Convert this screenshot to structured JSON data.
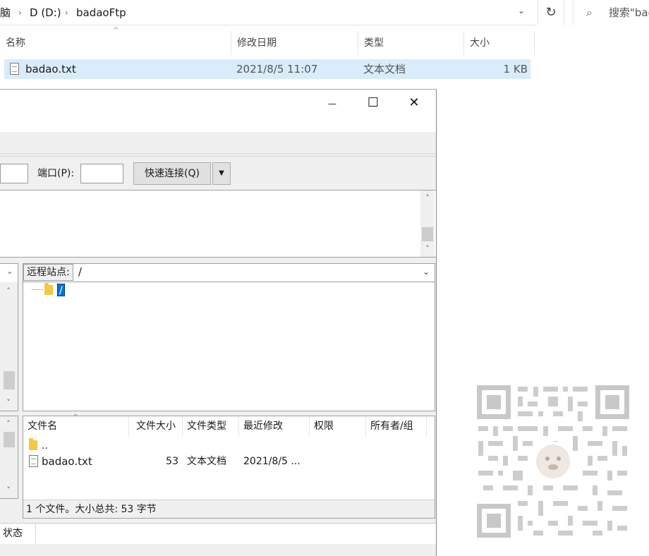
{
  "explorer": {
    "breadcrumb": [
      "脑",
      "D (D:)",
      "badaoFtp"
    ],
    "search_placeholder": "搜索\"bad",
    "columns": [
      "名称",
      "修改日期",
      "类型",
      "大小"
    ],
    "files": [
      {
        "name": "badao.txt",
        "modified": "2021/8/5 11:07",
        "type": "文本文档",
        "size": "1 KB"
      }
    ]
  },
  "filezilla": {
    "window_controls": {
      "minimize": "—",
      "maximize": "☐",
      "close": "✕"
    },
    "quickconnect": {
      "port_label": "端口(P):",
      "port_value": "",
      "connect_button": "快速连接(Q)",
      "dropdown": "▼"
    },
    "remote": {
      "site_label": "远程站点:",
      "site_path": "/",
      "tree_root": "/",
      "columns": [
        "文件名",
        "文件大小",
        "文件类型",
        "最近修改",
        "权限",
        "所有者/组"
      ],
      "rows": [
        {
          "name": "..",
          "size": "",
          "type": "",
          "modified": ""
        },
        {
          "name": "badao.txt",
          "size": "53",
          "type": "文本文档",
          "modified": "2021/8/5 ..."
        }
      ],
      "summary": "1 个文件。大小总共: 53 字节"
    },
    "status_tab": "状态"
  },
  "icons": {
    "chevron_right": "›",
    "chevron_down": "⌄",
    "refresh": "↻",
    "search": "⌕",
    "scroll_up": "˄",
    "scroll_down": "˅"
  }
}
